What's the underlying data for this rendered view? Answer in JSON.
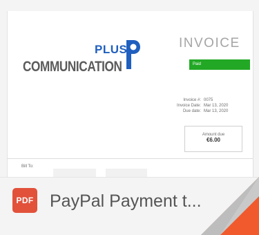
{
  "logo": {
    "plus_text": "PLUS",
    "main_text": "COMMUNICATION",
    "p_mark_icon": "p-letter-mark-icon"
  },
  "invoice": {
    "title": "INVOICE",
    "status": "Paid",
    "meta": [
      {
        "label": "Invoice #:",
        "value": "0075"
      },
      {
        "label": "Invoice Date:",
        "value": "Mar 13, 2020"
      },
      {
        "label": "Due date:",
        "value": "Mar 13, 2020"
      }
    ],
    "amount_due_label": "Amount due",
    "amount_due_value": "€6.00",
    "bill_to": "Bill To:"
  },
  "file": {
    "type_badge": "PDF",
    "title": "PayPal Payment t..."
  },
  "colors": {
    "status_green": "#22a825",
    "pdf_red": "#e2513a",
    "brand_blue": "#1f5fbf",
    "fold_orange": "#f05a2c"
  }
}
